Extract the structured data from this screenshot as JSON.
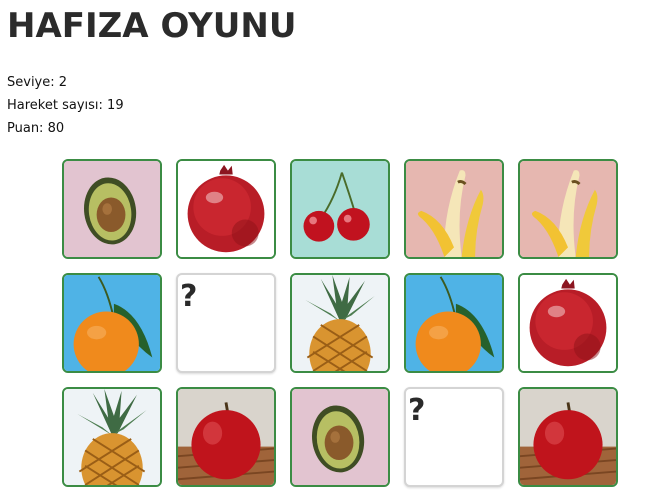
{
  "title": "HAFIZA OYUNU",
  "stats": {
    "level_label": "Seviye:",
    "level": "2",
    "moves_label": "Hareket sayısı:",
    "moves": "19",
    "score_label": "Puan:",
    "score": "80"
  },
  "board": {
    "hidden_symbol": "?",
    "cards": [
      {
        "fruit": "avocado",
        "state": "revealed"
      },
      {
        "fruit": "pomegranate",
        "state": "revealed"
      },
      {
        "fruit": "cherry",
        "state": "revealed"
      },
      {
        "fruit": "banana",
        "state": "revealed"
      },
      {
        "fruit": "banana",
        "state": "revealed"
      },
      {
        "fruit": "orange",
        "state": "revealed"
      },
      {
        "fruit": "",
        "state": "hidden"
      },
      {
        "fruit": "pineapple",
        "state": "revealed"
      },
      {
        "fruit": "orange",
        "state": "revealed"
      },
      {
        "fruit": "pomegranate",
        "state": "revealed"
      },
      {
        "fruit": "pineapple",
        "state": "revealed"
      },
      {
        "fruit": "apple",
        "state": "revealed"
      },
      {
        "fruit": "avocado",
        "state": "revealed"
      },
      {
        "fruit": "",
        "state": "hidden"
      },
      {
        "fruit": "apple",
        "state": "revealed"
      }
    ]
  },
  "colors": {
    "matched_border": "#3b8c44",
    "hidden_border": "#d4d4d4"
  }
}
